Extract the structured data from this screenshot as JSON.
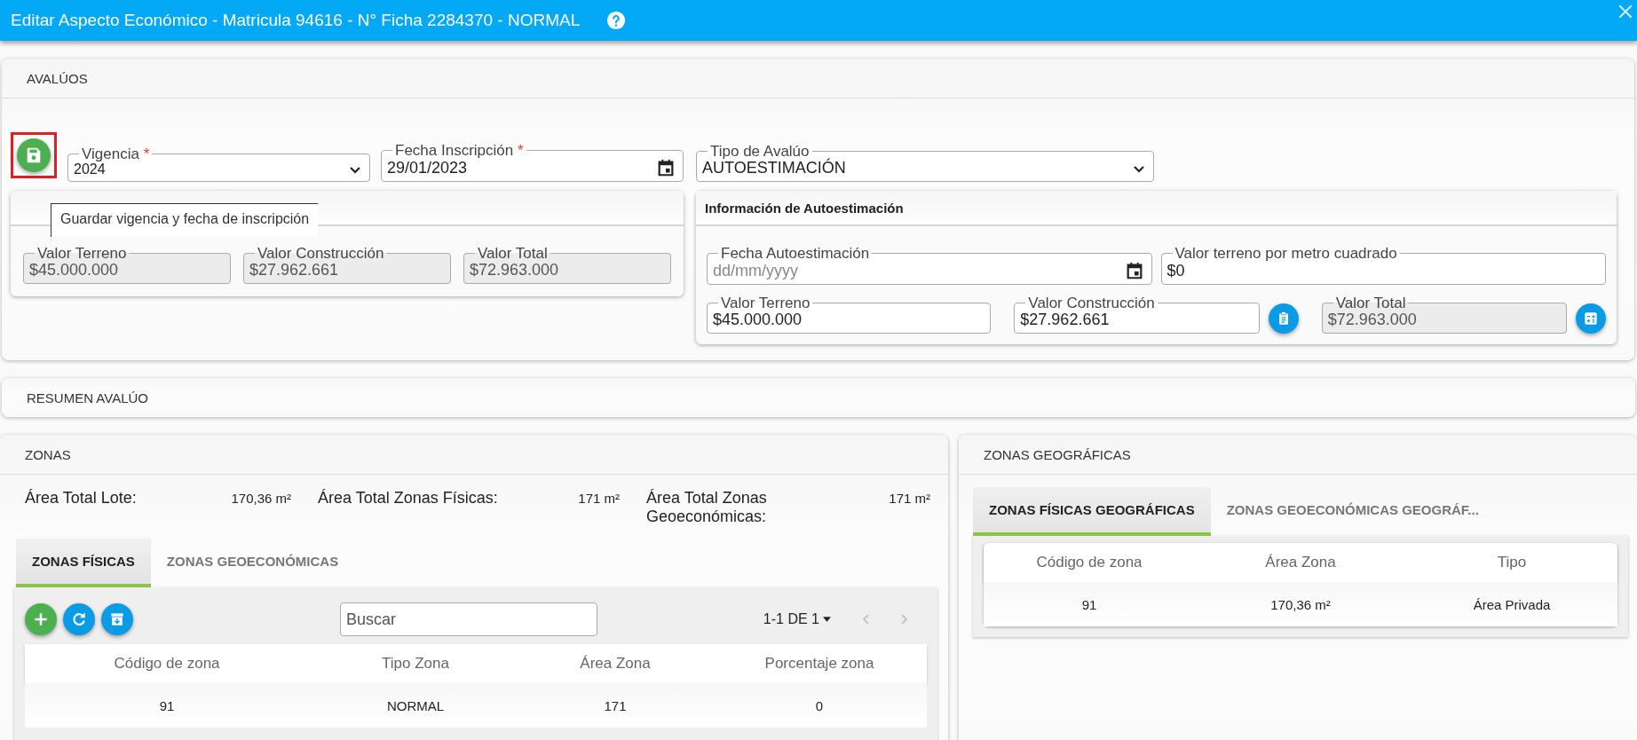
{
  "window": {
    "title": "Editar Aspecto Económico - Matricula 94616 - N° Ficha 2284370 - NORMAL"
  },
  "avaluos": {
    "title": "AVALÚOS",
    "tooltip": "Guardar vigencia y fecha de inscripción",
    "vigencia": {
      "label": "Vigencia",
      "required_mark": "*",
      "value": "2024"
    },
    "fecha_inscripcion": {
      "label": "Fecha Inscripción",
      "required_mark": "*",
      "value": "29/01/2023"
    },
    "tipo_avaluo": {
      "label": "Tipo de Avalúo",
      "value": "AUTOESTIMACIÓN"
    },
    "info_avaluo": {
      "fields": [
        {
          "label": "Valor Terreno",
          "value": "$45.000.000",
          "disabled": true
        },
        {
          "label": "Valor Construcción",
          "value": "$27.962.661",
          "disabled": true
        },
        {
          "label": "Valor Total",
          "value": "$72.963.000",
          "disabled": true
        }
      ]
    },
    "info_autoestimacion": {
      "title": "Información de Autoestimación",
      "fecha": {
        "label": "Fecha Autoestimación",
        "placeholder": "dd/mm/yyyy"
      },
      "valor_m2": {
        "label": "Valor terreno por metro cuadrado",
        "value": "$0"
      },
      "fields": [
        {
          "label": "Valor Terreno",
          "value": "$45.000.000",
          "disabled": false,
          "kind": "plain"
        },
        {
          "label": "Valor Construcción",
          "value": "$27.962.661",
          "disabled": false,
          "kind": "clipboard"
        },
        {
          "label": "Valor Total",
          "value": "$72.963.000",
          "disabled": true,
          "kind": "calculator"
        }
      ]
    }
  },
  "resumen": {
    "title": "RESUMEN AVALÚO"
  },
  "zonas": {
    "title": "ZONAS",
    "totals": [
      {
        "label": "Área Total Lote:",
        "value": "170,36 m²"
      },
      {
        "label": "Área Total Zonas Físicas:",
        "value": "171 m²"
      },
      {
        "label": "Área Total Zonas Geoeconómicas:",
        "value": "171 m²"
      }
    ],
    "tabs": [
      {
        "label": "ZONAS FÍSICAS",
        "selected": true
      },
      {
        "label": "ZONAS GEOECONÓMICAS",
        "selected": false
      }
    ],
    "search": {
      "placeholder": "Buscar"
    },
    "pagination": "1-1 DE 1",
    "table": {
      "columns": [
        "Código de zona",
        "Tipo Zona",
        "Área Zona",
        "Porcentaje zona"
      ],
      "rows": [
        [
          "91",
          "NORMAL",
          "171",
          "0"
        ]
      ]
    }
  },
  "zonas_geograficas": {
    "title": "ZONAS GEOGRÁFICAS",
    "tabs": [
      {
        "label": "ZONAS FÍSICAS GEOGRÁFICAS",
        "selected": true
      },
      {
        "label": "ZONAS GEOECONÓMICAS GEOGRÁF...",
        "selected": false
      }
    ],
    "table": {
      "columns": [
        "Código de zona",
        "Área Zona",
        "Tipo"
      ],
      "rows": [
        [
          "91",
          "170,36 m²",
          "Área Privada"
        ]
      ]
    }
  }
}
